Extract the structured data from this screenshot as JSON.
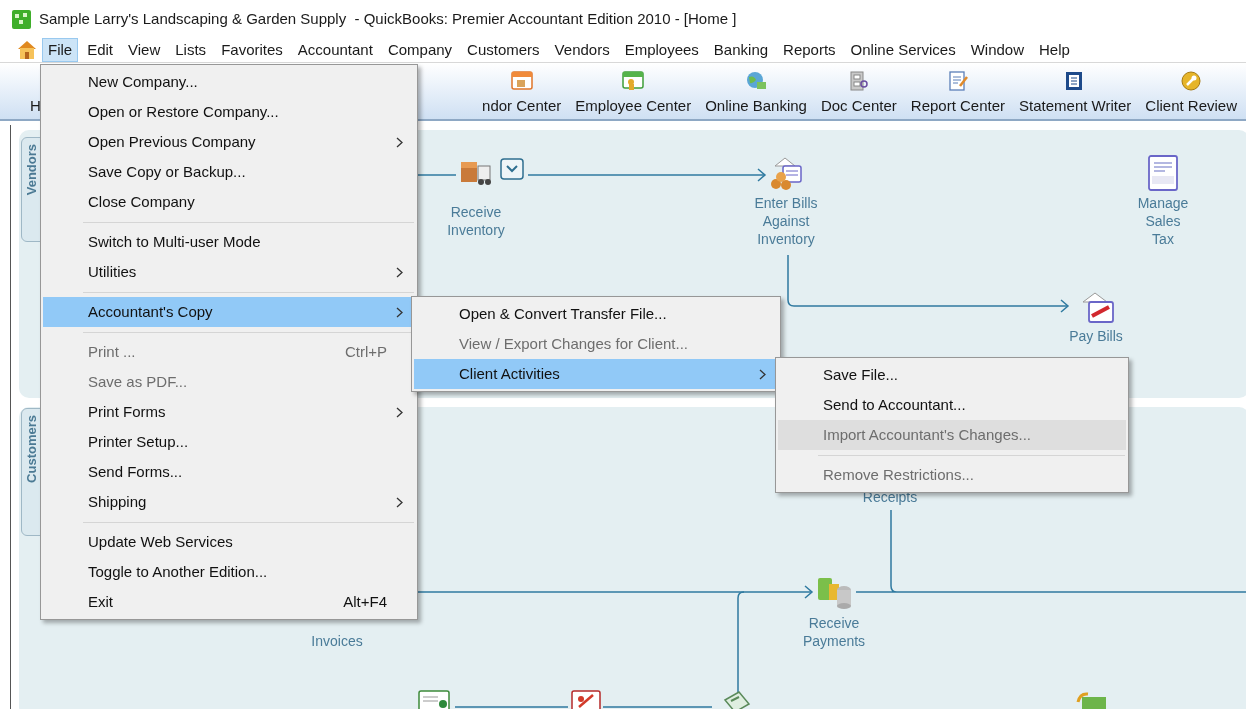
{
  "window": {
    "title": "Sample Larry's Landscaping & Garden Supply  - QuickBooks: Premier Accountant Edition 2010 - [Home ]"
  },
  "menu_bar": [
    {
      "label": "File",
      "selected": true
    },
    {
      "label": "Edit",
      "selected": false
    },
    {
      "label": "View",
      "selected": false
    },
    {
      "label": "Lists",
      "selected": false
    },
    {
      "label": "Favorites",
      "selected": false
    },
    {
      "label": "Accountant",
      "selected": false
    },
    {
      "label": "Company",
      "selected": false
    },
    {
      "label": "Customers",
      "selected": false
    },
    {
      "label": "Vendors",
      "selected": false
    },
    {
      "label": "Employees",
      "selected": false
    },
    {
      "label": "Banking",
      "selected": false
    },
    {
      "label": "Reports",
      "selected": false
    },
    {
      "label": "Online Services",
      "selected": false
    },
    {
      "label": "Window",
      "selected": false
    },
    {
      "label": "Help",
      "selected": false
    }
  ],
  "toolbar": [
    {
      "label": "H"
    },
    {
      "label": "ndor Center"
    },
    {
      "label": "Employee Center"
    },
    {
      "label": "Online Banking"
    },
    {
      "label": "Doc Center"
    },
    {
      "label": "Report Center"
    },
    {
      "label": "Statement Writer"
    },
    {
      "label": "Client Review"
    }
  ],
  "side_tabs": [
    {
      "label": "Vendors"
    },
    {
      "label": "Customers"
    }
  ],
  "workflow_nodes": [
    {
      "label": "Receive Inventory"
    },
    {
      "label": "Enter Bills Against Inventory"
    },
    {
      "label": "Manage Sales Tax"
    },
    {
      "label": "Pay Bills"
    },
    {
      "label": "Receipts"
    },
    {
      "label": "Invoices"
    },
    {
      "label": "Receive Payments"
    }
  ],
  "file_menu": [
    {
      "kind": "item",
      "label": "New Company...",
      "disabled": false,
      "selected": false,
      "submenu": false
    },
    {
      "kind": "item",
      "label": "Open or Restore Company...",
      "disabled": false,
      "selected": false,
      "submenu": false
    },
    {
      "kind": "item",
      "label": "Open Previous Company",
      "disabled": false,
      "selected": false,
      "submenu": true
    },
    {
      "kind": "item",
      "label": "Save Copy or Backup...",
      "disabled": false,
      "selected": false,
      "submenu": false
    },
    {
      "kind": "item",
      "label": "Close Company",
      "disabled": false,
      "selected": false,
      "submenu": false
    },
    {
      "kind": "separator"
    },
    {
      "kind": "item",
      "label": "Switch to Multi-user Mode",
      "disabled": false,
      "selected": false,
      "submenu": false
    },
    {
      "kind": "item",
      "label": "Utilities",
      "disabled": false,
      "selected": false,
      "submenu": true
    },
    {
      "kind": "separator"
    },
    {
      "kind": "item",
      "label": "Accountant's Copy",
      "disabled": false,
      "selected": true,
      "submenu": true
    },
    {
      "kind": "separator"
    },
    {
      "kind": "item",
      "label": "Print ...",
      "shortcut": "Ctrl+P",
      "disabled": true,
      "selected": false,
      "submenu": false
    },
    {
      "kind": "item",
      "label": "Save as PDF...",
      "disabled": true,
      "selected": false,
      "submenu": false
    },
    {
      "kind": "item",
      "label": "Print Forms",
      "disabled": false,
      "selected": false,
      "submenu": true
    },
    {
      "kind": "item",
      "label": "Printer Setup...",
      "disabled": false,
      "selected": false,
      "submenu": false
    },
    {
      "kind": "item",
      "label": "Send Forms...",
      "disabled": false,
      "selected": false,
      "submenu": false
    },
    {
      "kind": "item",
      "label": "Shipping",
      "disabled": false,
      "selected": false,
      "submenu": true
    },
    {
      "kind": "separator"
    },
    {
      "kind": "item",
      "label": "Update Web Services",
      "disabled": false,
      "selected": false,
      "submenu": false
    },
    {
      "kind": "item",
      "label": "Toggle to Another Edition...",
      "disabled": false,
      "selected": false,
      "submenu": false
    },
    {
      "kind": "item",
      "label": "Exit",
      "shortcut": "Alt+F4",
      "disabled": false,
      "selected": false,
      "submenu": false
    }
  ],
  "accountants_copy_menu": [
    {
      "kind": "item",
      "label": "Open & Convert Transfer File...",
      "disabled": false,
      "selected": false,
      "submenu": false
    },
    {
      "kind": "item",
      "label": "View / Export Changes for Client...",
      "disabled": true,
      "selected": false,
      "submenu": false
    },
    {
      "kind": "item",
      "label": "Client Activities",
      "disabled": false,
      "selected": true,
      "submenu": true
    }
  ],
  "client_activities_menu": [
    {
      "kind": "item",
      "label": "Save File...",
      "disabled": false,
      "selected": false,
      "submenu": false
    },
    {
      "kind": "item",
      "label": "Send to Accountant...",
      "disabled": false,
      "selected": false,
      "submenu": false
    },
    {
      "kind": "item",
      "label": "Import Accountant's Changes...",
      "disabled": true,
      "selected": true,
      "submenu": false
    },
    {
      "kind": "separator"
    },
    {
      "kind": "item",
      "label": "Remove Restrictions...",
      "disabled": true,
      "selected": false,
      "submenu": false
    }
  ]
}
